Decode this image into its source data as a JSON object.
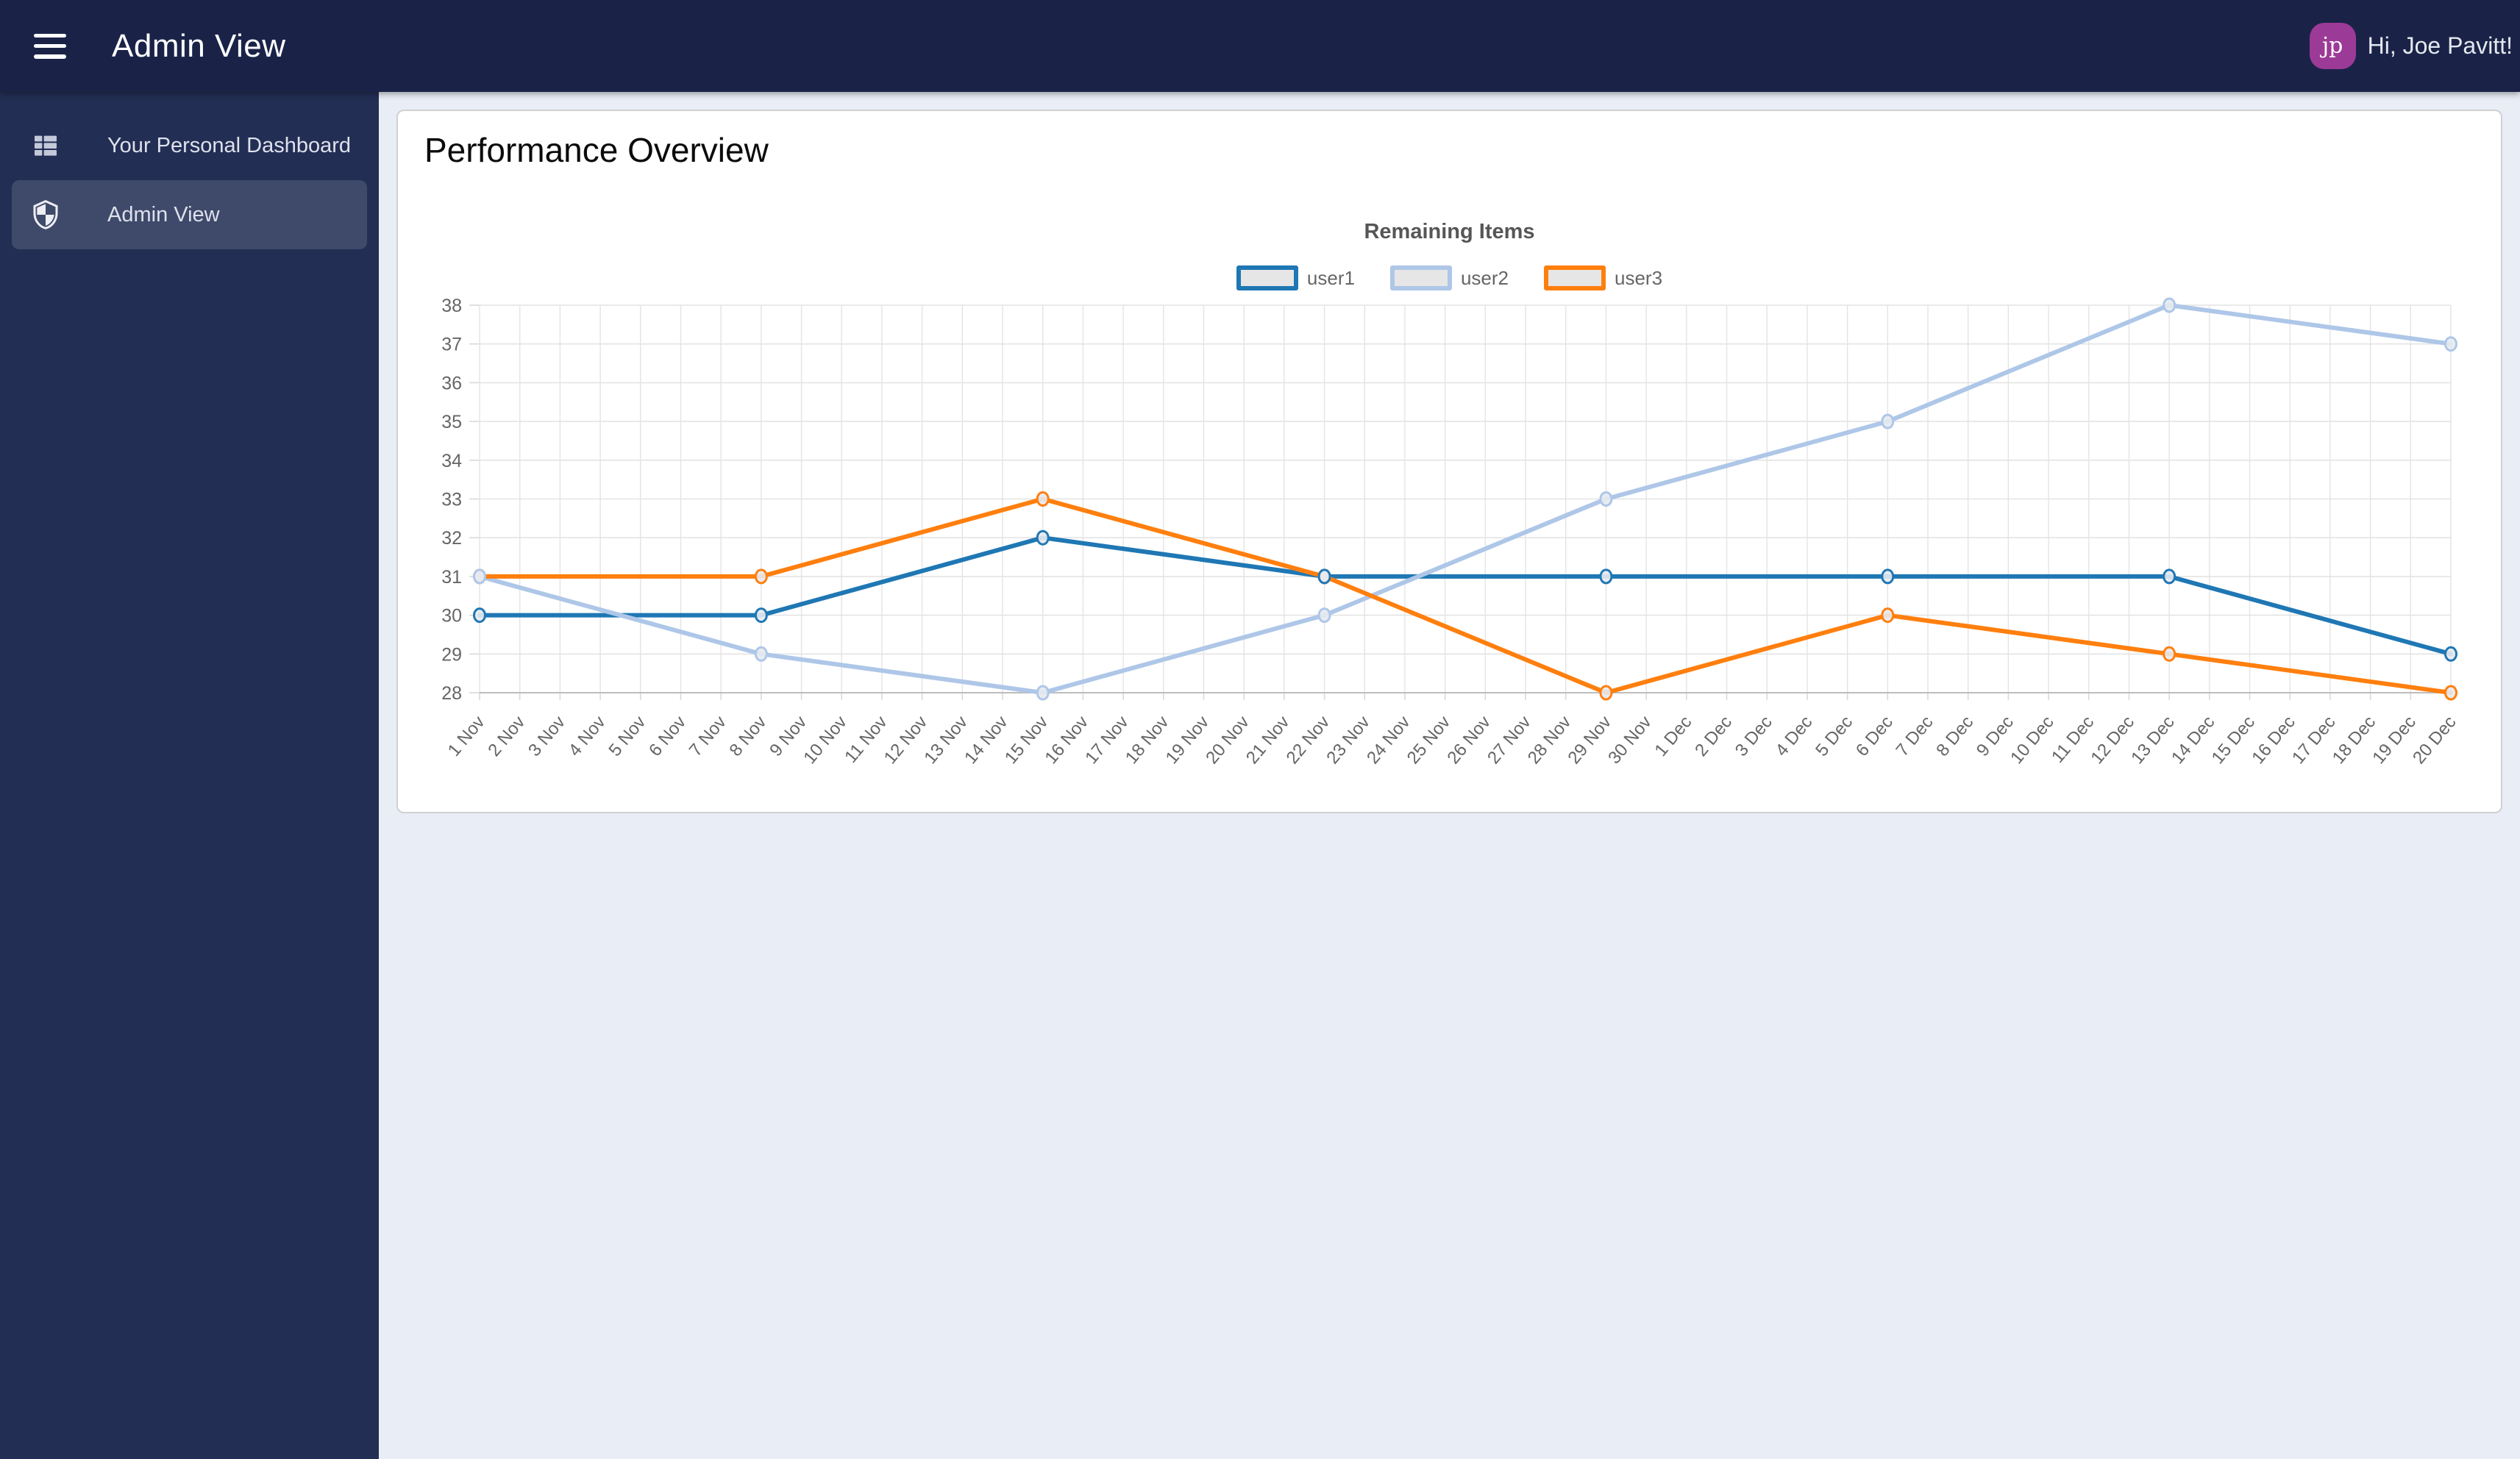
{
  "colors": {
    "topbar": "#1a2347",
    "sidebar": "#232e54",
    "sidebar_selected": "rgba(255,255,255,0.13)",
    "avatar": "#9c3a97",
    "main_background": "#e9edf6",
    "grid_line": "#e4e4e4",
    "tick_text": "#666666"
  },
  "topbar": {
    "title": "Admin View",
    "greeting": "Hi, Joe Pavitt!",
    "avatar_initials": "jp"
  },
  "sidebar": {
    "items": [
      {
        "label": "Your Personal Dashboard",
        "icon": "dashboard-grid-icon",
        "selected": false
      },
      {
        "label": "Admin View",
        "icon": "shield-icon",
        "selected": true
      }
    ]
  },
  "card": {
    "title": "Performance Overview"
  },
  "chart_data": {
    "type": "line",
    "title": "Remaining Items",
    "xlabel": "",
    "ylabel": "",
    "ylim": [
      28,
      38
    ],
    "y_ticks": [
      28,
      29,
      30,
      31,
      32,
      33,
      34,
      35,
      36,
      37,
      38
    ],
    "grid": true,
    "legend_position": "top-center",
    "x_labels": [
      "1 Nov",
      "2 Nov",
      "3 Nov",
      "4 Nov",
      "5 Nov",
      "6 Nov",
      "7 Nov",
      "8 Nov",
      "9 Nov",
      "10 Nov",
      "11 Nov",
      "12 Nov",
      "13 Nov",
      "14 Nov",
      "15 Nov",
      "16 Nov",
      "17 Nov",
      "18 Nov",
      "19 Nov",
      "20 Nov",
      "21 Nov",
      "22 Nov",
      "23 Nov",
      "24 Nov",
      "25 Nov",
      "26 Nov",
      "27 Nov",
      "28 Nov",
      "29 Nov",
      "30 Nov",
      "1 Dec",
      "2 Dec",
      "3 Dec",
      "4 Dec",
      "5 Dec",
      "6 Dec",
      "7 Dec",
      "8 Dec",
      "9 Dec",
      "10 Dec",
      "11 Dec",
      "12 Dec",
      "13 Dec",
      "14 Dec",
      "15 Dec",
      "16 Dec",
      "17 Dec",
      "18 Dec",
      "19 Dec",
      "20 Dec"
    ],
    "point_dates": [
      "1 Nov",
      "8 Nov",
      "15 Nov",
      "22 Nov",
      "29 Nov",
      "6 Dec",
      "13 Dec",
      "20 Dec"
    ],
    "point_indices": [
      0,
      7,
      14,
      21,
      28,
      35,
      42,
      49
    ],
    "series": [
      {
        "name": "user1",
        "color": "#1f77b4",
        "values": [
          30,
          30,
          32,
          31,
          31,
          31,
          31,
          29
        ]
      },
      {
        "name": "user2",
        "color": "#aec7e8",
        "values": [
          31,
          29,
          28,
          30,
          33,
          35,
          38,
          37
        ]
      },
      {
        "name": "user3",
        "color": "#ff7f0e",
        "values": [
          31,
          31,
          33,
          31,
          28,
          30,
          29,
          28
        ]
      }
    ]
  }
}
